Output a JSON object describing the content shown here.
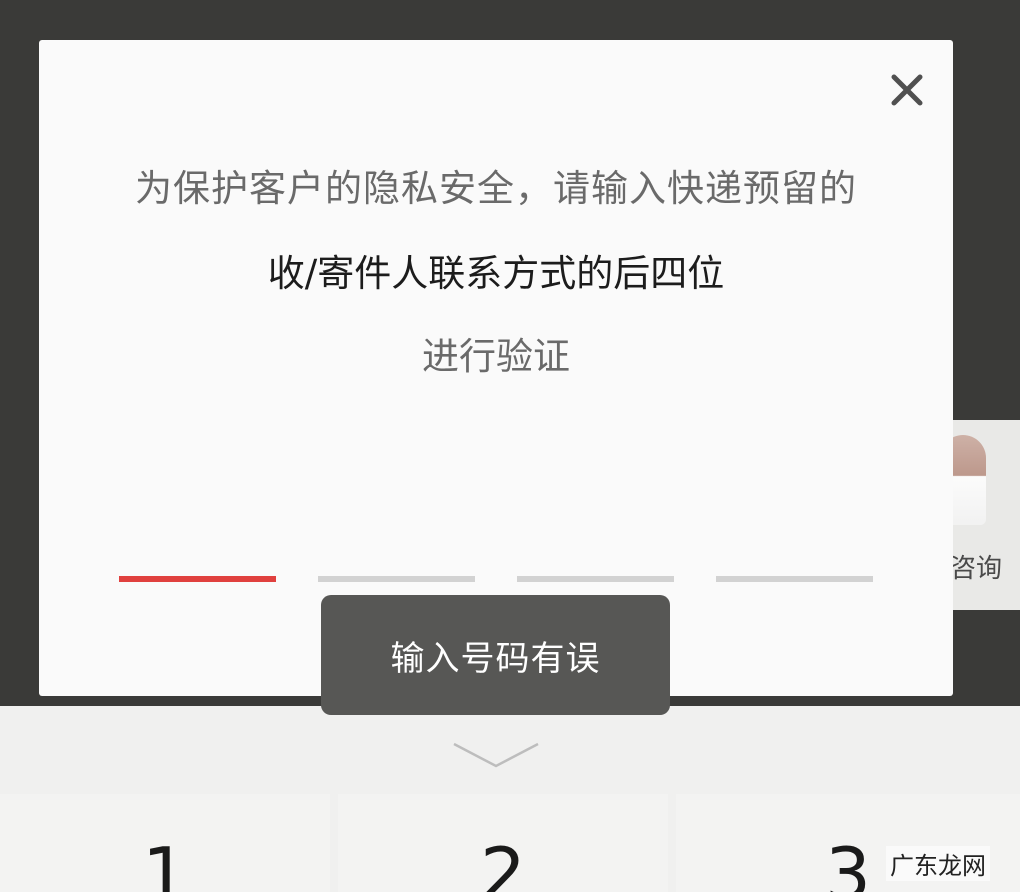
{
  "background": {
    "consult_label": "咨询"
  },
  "dialog": {
    "close_icon": "close-icon",
    "message_line1": "为保护客户的隐私安全，请输入快递预留的",
    "message_line2": "收/寄件人联系方式的后四位",
    "message_line3": "进行验证",
    "digit_slots": [
      {
        "filled": true
      },
      {
        "filled": false
      },
      {
        "filled": false
      },
      {
        "filled": false
      }
    ],
    "accent_color": "#e0403e"
  },
  "toast": {
    "message": "输入号码有误"
  },
  "keypad": {
    "collapse_icon": "chevron-down-icon",
    "keys": [
      "1",
      "2",
      "3"
    ]
  },
  "watermark": {
    "text": "广东龙网"
  }
}
